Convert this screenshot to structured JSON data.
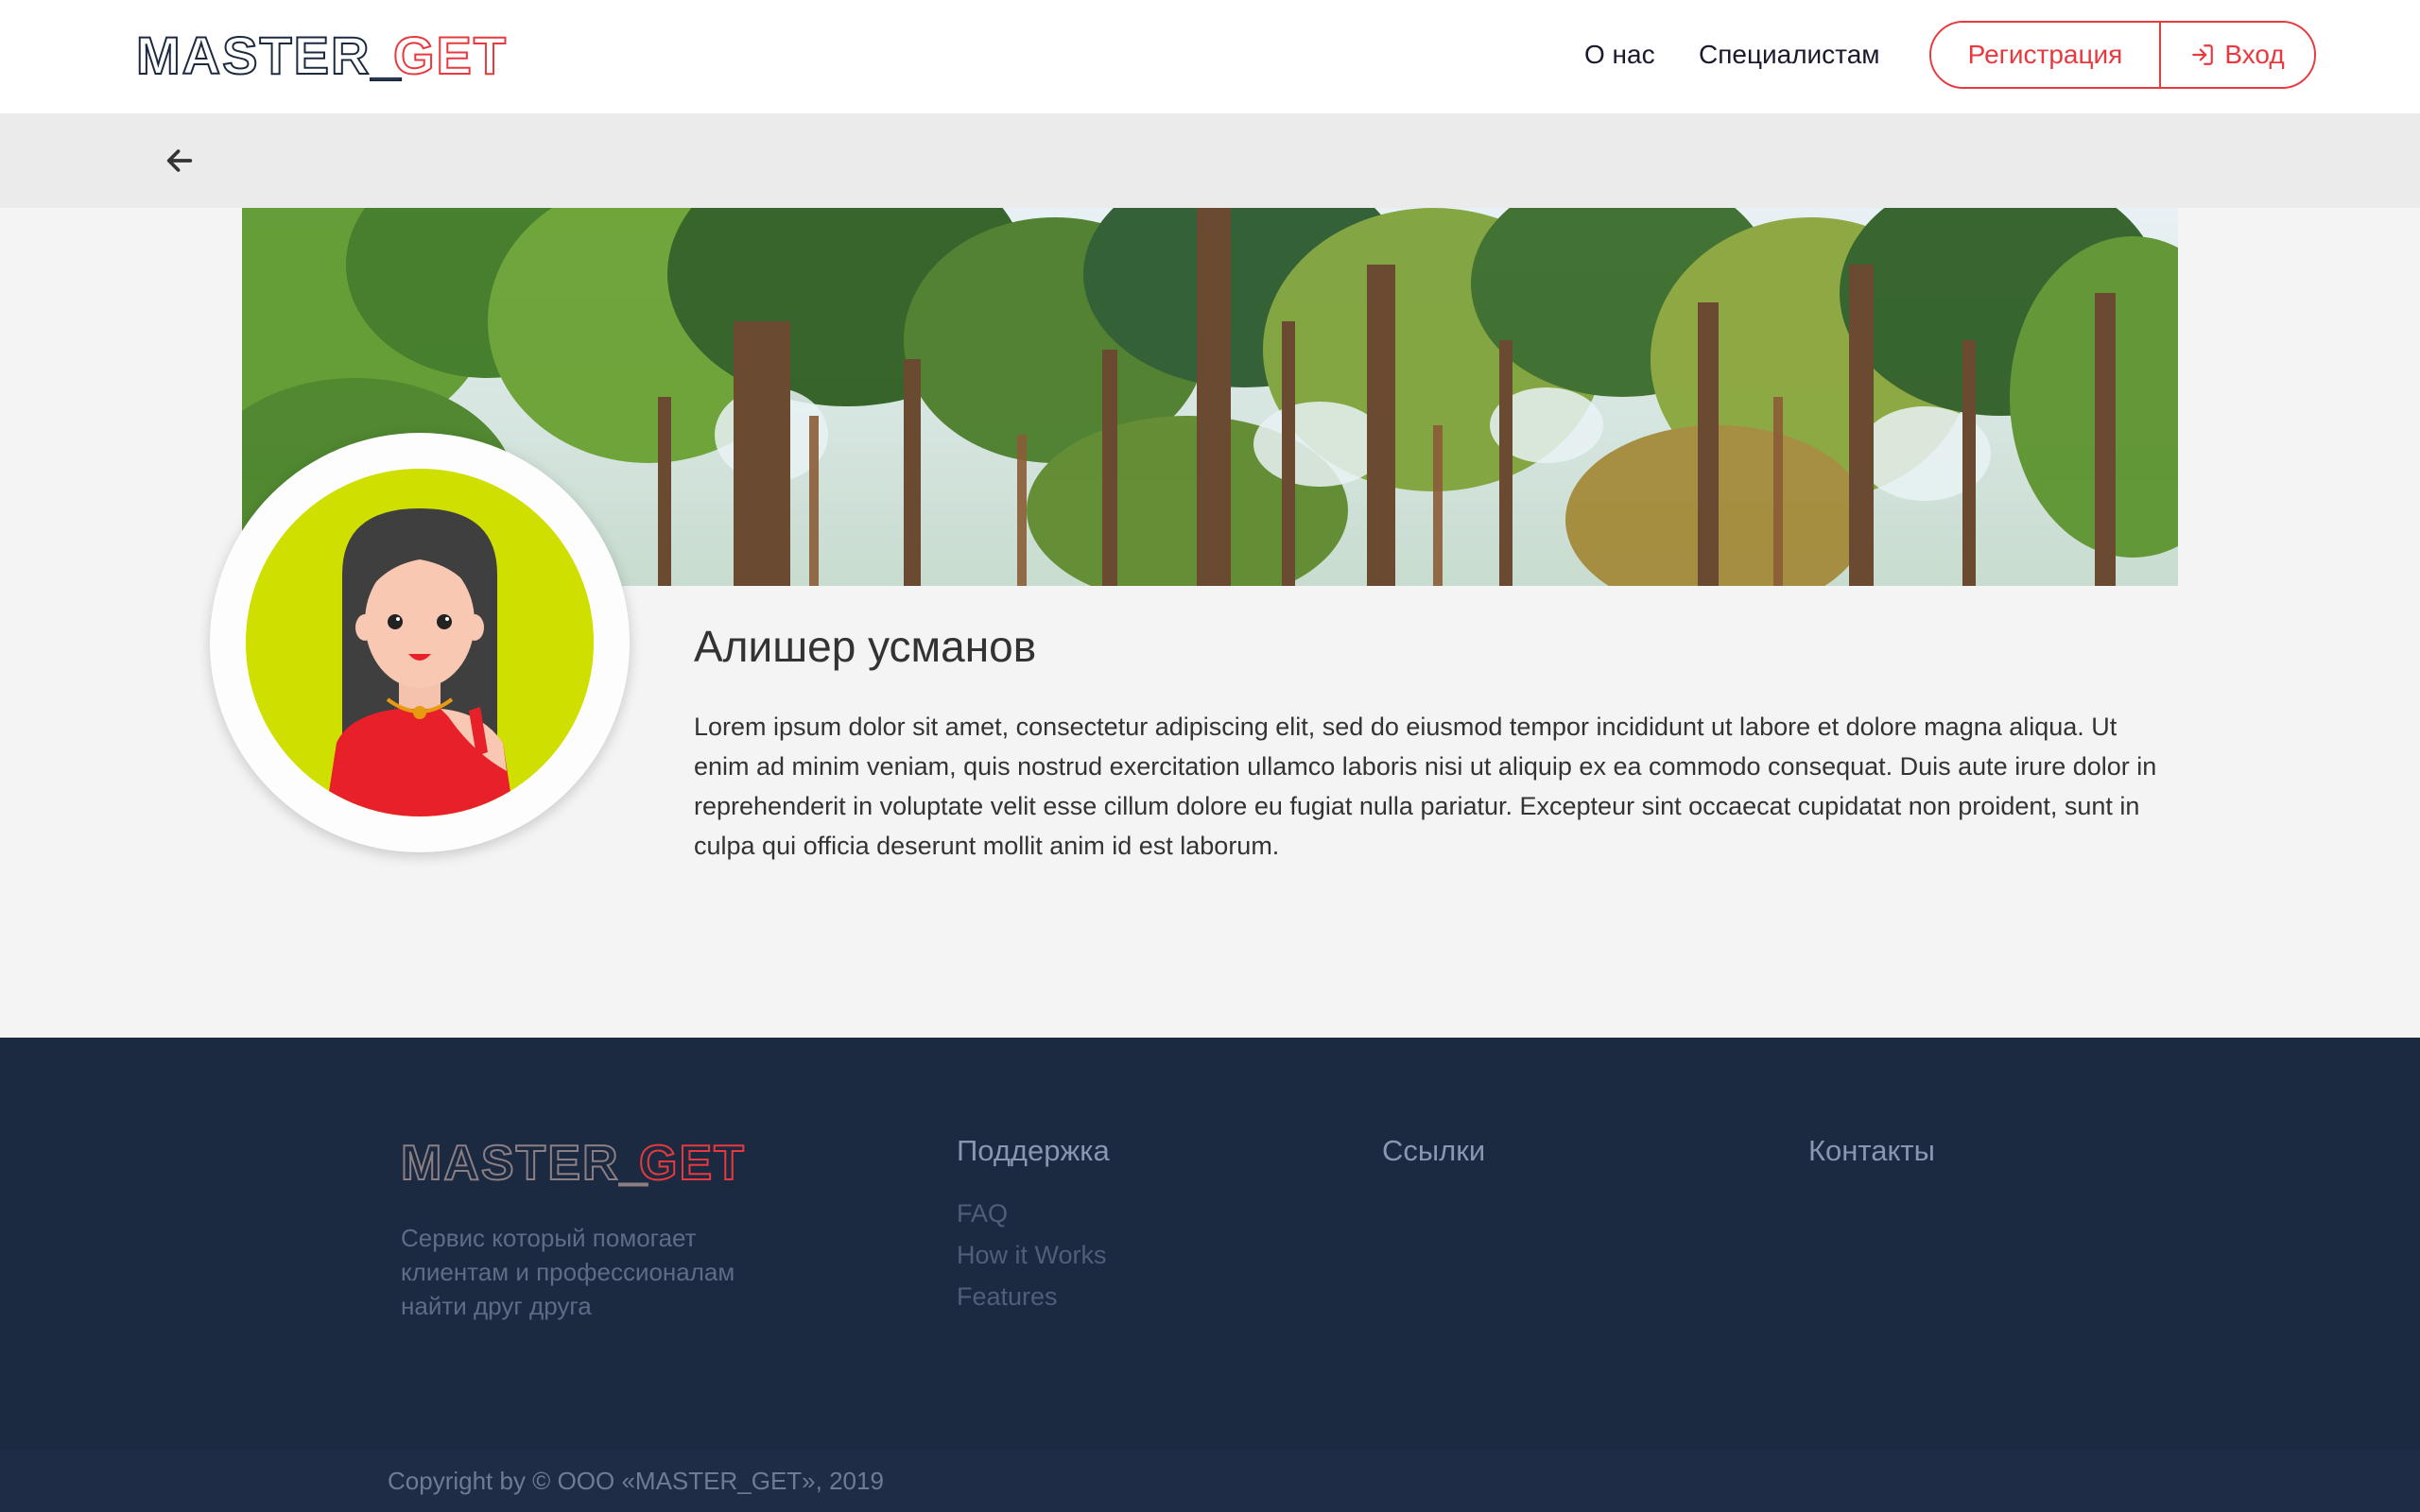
{
  "brand": {
    "logo_part1": "MASTER_",
    "logo_part2": "GET",
    "color_dark": "#1b2a41",
    "color_accent": "#e8393f"
  },
  "header": {
    "nav": [
      {
        "label": "О нас"
      },
      {
        "label": "Специалистам"
      }
    ],
    "register_label": "Регистрация",
    "login_label": "Вход",
    "login_icon": "login-icon"
  },
  "subbar": {
    "back_icon": "arrow-left-icon"
  },
  "profile": {
    "name": "Алишер усманов",
    "bio": "Lorem ipsum dolor sit amet, consectetur adipiscing elit, sed do eiusmod tempor incididunt ut labore et dolore magna aliqua. Ut enim ad minim veniam, quis nostrud exercitation ullamco laboris nisi ut aliquip ex ea commodo consequat. Duis aute irure dolor in reprehenderit in voluptate velit esse cillum dolore eu fugiat nulla pariatur. Excepteur sint occaecat cupidatat non proident, sunt in culpa qui officia deserunt mollit anim id est laborum."
  },
  "footer": {
    "description": "Сервис который помогает клиентам и профессионалам найти друг друга",
    "support_title": "Поддержка",
    "links_title": "Ссылки",
    "contacts_title": "Контакты",
    "support_links": [
      "FAQ",
      "How it Works",
      "Features"
    ],
    "copyright": "Copyright by © ООО «MASTER_GET», 2019"
  }
}
